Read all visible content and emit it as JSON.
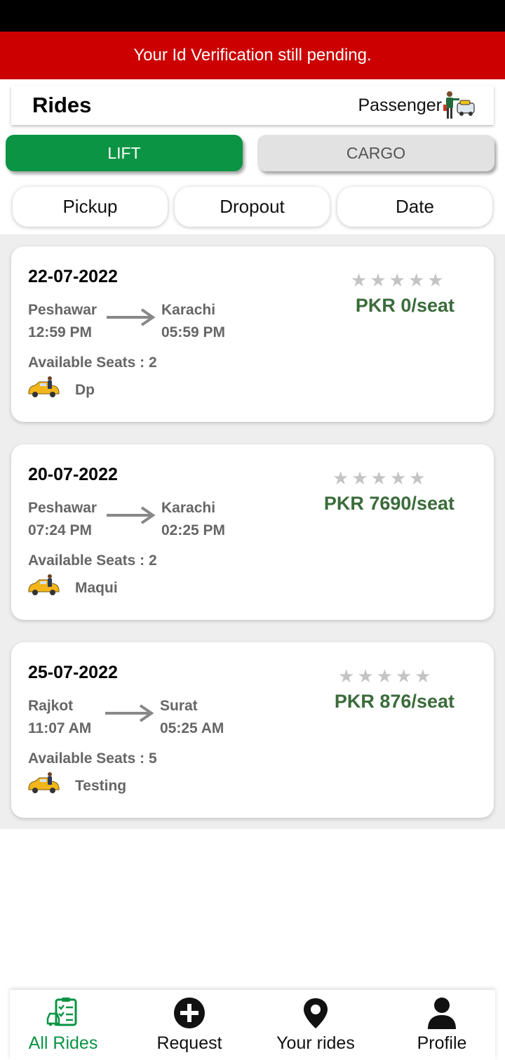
{
  "alert": {
    "text": "Your Id Verification still pending."
  },
  "header": {
    "title": "Rides",
    "role_label": "Passenger"
  },
  "tabs": {
    "lift": "LIFT",
    "cargo": "CARGO"
  },
  "filters": {
    "pickup": "Pickup",
    "dropout": "Dropout",
    "date": "Date"
  },
  "rides": [
    {
      "date": "22-07-2022",
      "from_city": "Peshawar",
      "from_time": "12:59 PM",
      "to_city": "Karachi",
      "to_time": "05:59 PM",
      "seats": "Available Seats : 2",
      "driver": "Dp",
      "price": "PKR 0/seat",
      "rating": 0
    },
    {
      "date": "20-07-2022",
      "from_city": "Peshawar",
      "from_time": "07:24 PM",
      "to_city": "Karachi",
      "to_time": "02:25 PM",
      "seats": "Available Seats : 2",
      "driver": "Maqui",
      "price": "PKR 7690/seat",
      "rating": 0
    },
    {
      "date": "25-07-2022",
      "from_city": "Rajkot",
      "from_time": "11:07 AM",
      "to_city": "Surat",
      "to_time": "05:25 AM",
      "seats": "Available Seats : 5",
      "driver": "Testing",
      "price": "PKR 876/seat",
      "rating": 0
    }
  ],
  "nav": {
    "all_rides": "All Rides",
    "request": "Request",
    "your_rides": "Your rides",
    "profile": "Profile"
  },
  "colors": {
    "alert": "#cc0000",
    "accent": "#0a9444",
    "price": "#3b6b3b"
  }
}
